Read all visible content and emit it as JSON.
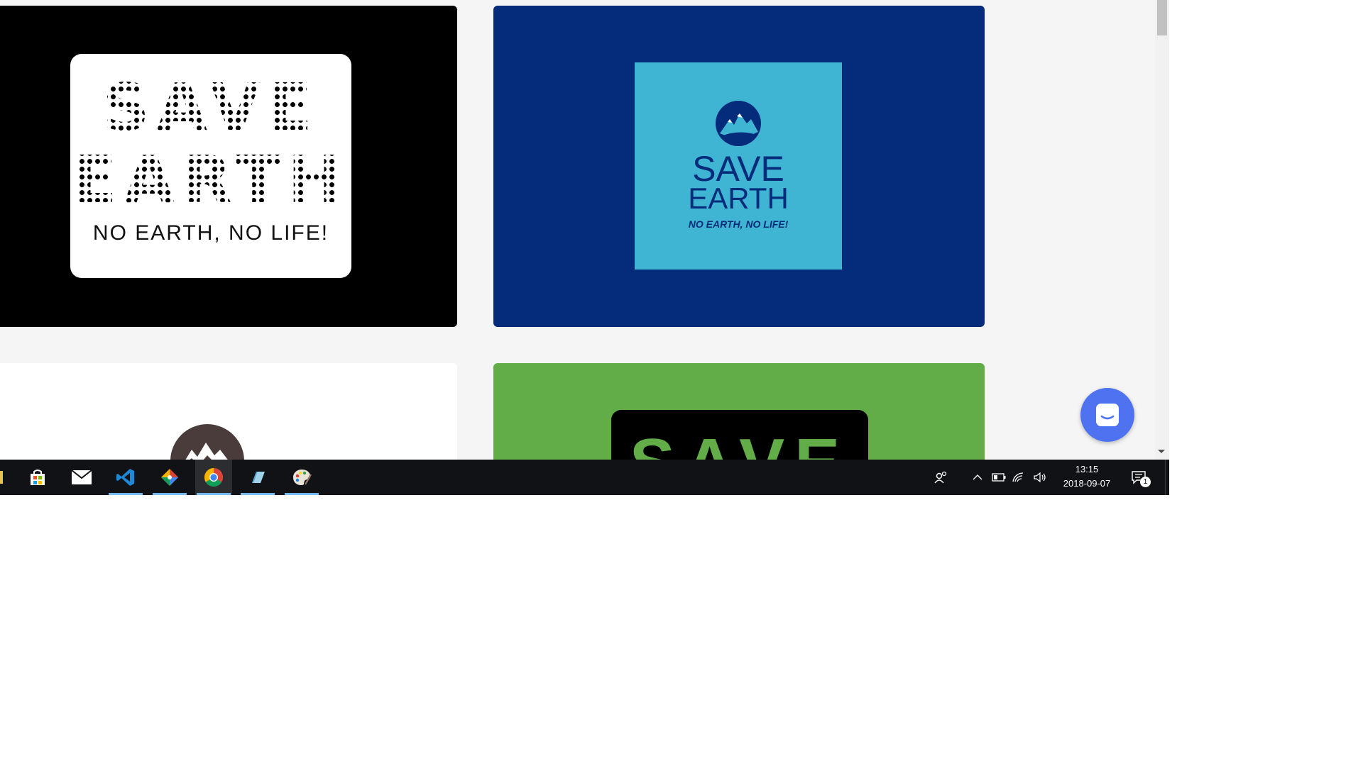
{
  "cards": {
    "card1": {
      "line1": "SAVE",
      "line2": "EARTH",
      "subtitle": "NO EARTH, NO LIFE!"
    },
    "card2": {
      "line1": "SAVE",
      "line2": "EARTH",
      "subtitle": "NO EARTH, NO LIFE!"
    },
    "card4": {
      "line1": "SAVE"
    }
  },
  "colors": {
    "card1_bg": "#000000",
    "card2_bg": "#052c7a",
    "card2_panel": "#3fb4d3",
    "card3_bg": "#ffffff",
    "card4_bg": "#62ad48",
    "chat_button": "#4f73f0",
    "taskbar": "#101216"
  },
  "chat_button": {
    "icon": "chat-bubble-icon"
  },
  "taskbar": {
    "apps": [
      {
        "name": "microsoft-store-icon"
      },
      {
        "name": "mail-icon"
      },
      {
        "name": "vscode-icon"
      },
      {
        "name": "git-client-icon"
      },
      {
        "name": "chrome-icon"
      },
      {
        "name": "eraser-app-icon"
      },
      {
        "name": "paint-palette-icon"
      }
    ],
    "tray": {
      "time": "13:15",
      "date": "2018-09-07",
      "notification_count": "1"
    }
  }
}
